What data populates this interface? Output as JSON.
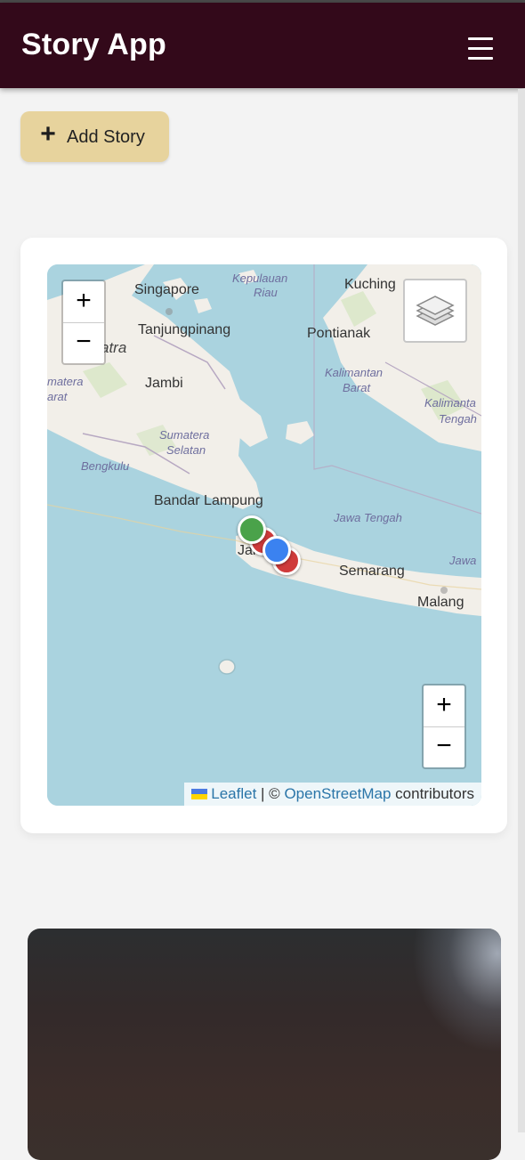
{
  "header": {
    "title": "Story App",
    "menu_icon": "hamburger-menu-icon",
    "background": "#33091a"
  },
  "actions": {
    "add_story_label": "Add Story",
    "add_story_color": "#e7d39d"
  },
  "map": {
    "zoom_in": "+",
    "zoom_out": "−",
    "layers_icon": "layers-icon",
    "attribution": {
      "leaflet": "Leaflet",
      "separator": " | © ",
      "osm": "OpenStreetMap",
      "suffix": " contributors"
    },
    "places": [
      "Singapore",
      "Kepulauan",
      "Riau",
      "Kuching",
      "Tanjungpinang",
      "Pontianak",
      "atra",
      "Jambi",
      "matera",
      "arat",
      "Kalimantan",
      "Barat",
      "Kalimanta",
      "Tengah",
      "Sumatera",
      "Selatan",
      "Bengkulu",
      "Bandar Lampung",
      "Jawa Tengah",
      "Jaka",
      "Semarang",
      "Jawa",
      "Malang"
    ],
    "markers": [
      {
        "color": "#4aa24a"
      },
      {
        "color": "#cf3b3b"
      },
      {
        "color": "#3b82f0"
      },
      {
        "color": "#cf3b3b"
      }
    ]
  },
  "story_card": {
    "image": "story-photo"
  }
}
